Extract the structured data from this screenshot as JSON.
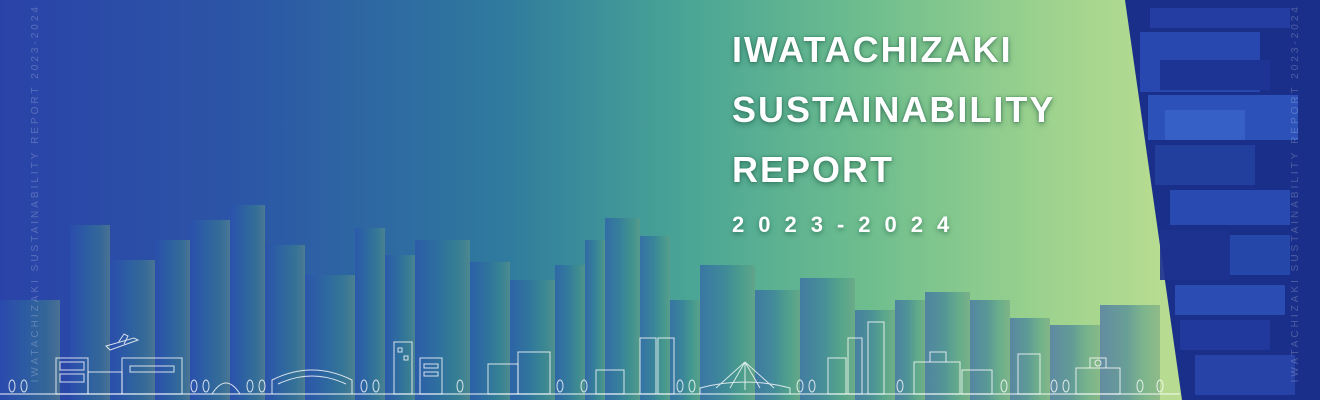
{
  "banner": {
    "title_lines": [
      "IWATACHIZAKI",
      "SUSTAINABILITY",
      "REPORT"
    ],
    "year": "2023-2024",
    "side_text": "IWATACHIZAKI   SUSTAINABILITY   REPORT   2023-2024"
  },
  "colors": {
    "gradient_start": "#2a43a8",
    "gradient_mid": "#4aa595",
    "gradient_end": "#b7dc91",
    "right_panel": "#1a2f8a",
    "title_text": "#ffffff"
  },
  "icons": [
    "airplane-icon",
    "city-skyline",
    "stadium-icon",
    "bridge-icon",
    "tree-icon"
  ]
}
